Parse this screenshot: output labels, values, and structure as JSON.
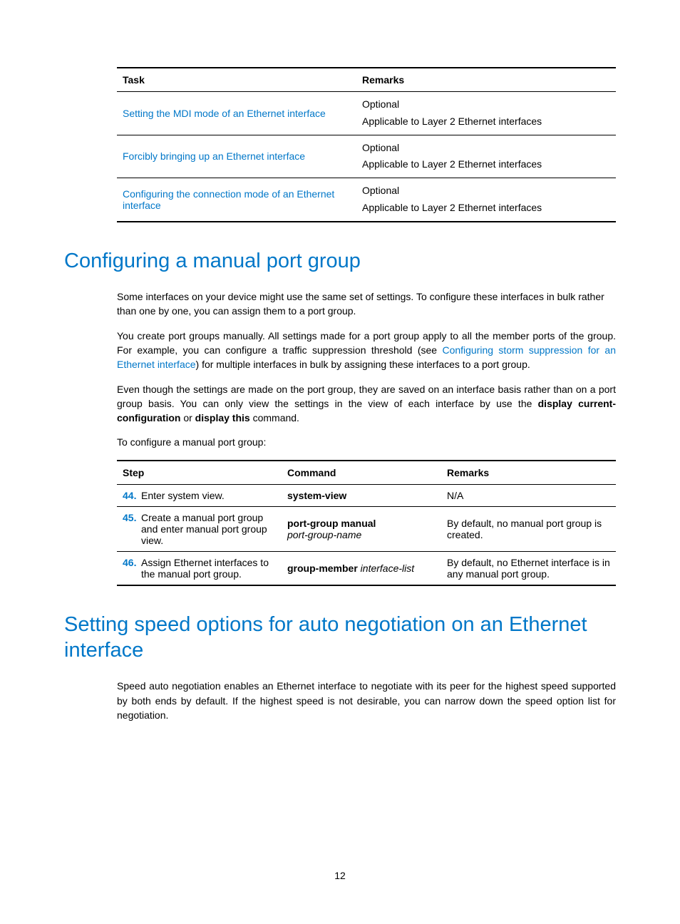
{
  "table1": {
    "headers": {
      "task": "Task",
      "remarks": "Remarks"
    },
    "rows": [
      {
        "task": "Setting the MDI mode of an Ethernet interface",
        "remark1": "Optional",
        "remark2": "Applicable to Layer 2 Ethernet interfaces"
      },
      {
        "task": "Forcibly bringing up an Ethernet interface",
        "remark1": "Optional",
        "remark2": "Applicable to Layer 2 Ethernet interfaces"
      },
      {
        "task": "Configuring the connection mode of an Ethernet interface",
        "remark1": "Optional",
        "remark2": "Applicable to Layer 2 Ethernet interfaces"
      }
    ]
  },
  "heading1": "Configuring a manual port group",
  "para1": "Some interfaces on your device might use the same set of settings. To configure these interfaces in bulk rather than one by one, you can assign them to a port group.",
  "para2_a": "You create port groups manually. All settings made for a port group apply to all the member ports of the group. For example, you can configure a traffic suppression threshold (see ",
  "para2_link": "Configuring storm suppression for an Ethernet interface",
  "para2_b": ") for multiple interfaces in bulk by assigning these interfaces to a port group.",
  "para3_a": "Even though the settings are made on the port group, they are saved on an interface basis rather than on a port group basis. You can only view the settings in the view of each interface by use the ",
  "para3_bold1": "display current-configuration",
  "para3_mid": " or ",
  "para3_bold2": "display this",
  "para3_b": " command.",
  "para4": "To configure a manual port group:",
  "table2": {
    "headers": {
      "step": "Step",
      "command": "Command",
      "remarks": "Remarks"
    },
    "rows": [
      {
        "num": "44.",
        "step": "Enter system view.",
        "cmd_bold": "system-view",
        "cmd_italic": "",
        "remark": "N/A"
      },
      {
        "num": "45.",
        "step": "Create a manual port group and enter manual port group view.",
        "cmd_bold": "port-group manual",
        "cmd_italic": "port-group-name",
        "remark": "By default, no manual port group is created."
      },
      {
        "num": "46.",
        "step": "Assign Ethernet interfaces to the manual port group.",
        "cmd_bold": "group-member",
        "cmd_italic": " interface-list",
        "remark": "By default, no Ethernet interface is in any manual port group."
      }
    ]
  },
  "heading2": "Setting speed options for auto negotiation on an Ethernet interface",
  "para5": "Speed auto negotiation enables an Ethernet interface to negotiate with its peer for the highest speed supported by both ends by default. If the highest speed is not desirable, you can narrow down the speed option list for negotiation.",
  "pageNumber": "12"
}
